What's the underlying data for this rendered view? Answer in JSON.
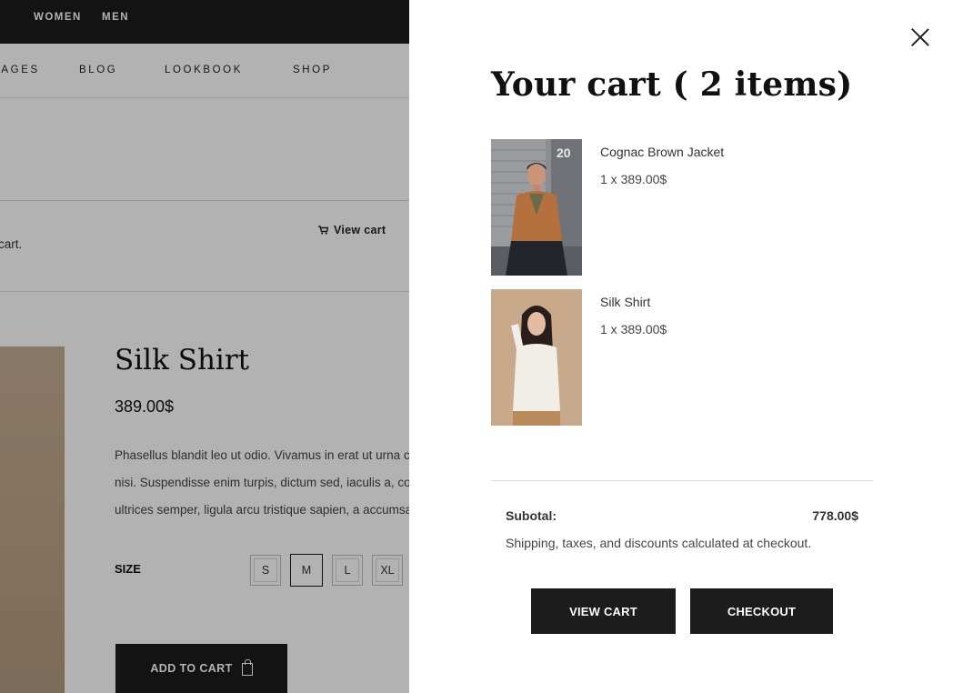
{
  "background": {
    "topbar": {
      "women": "WOMEN",
      "men": "MEN"
    },
    "nav": {
      "pages": "PAGES",
      "blog": "BLOG",
      "lookbook": "LOOKBOOK",
      "shop": "SHOP"
    },
    "notice": {
      "message": "cart.",
      "view_cart": "View cart"
    },
    "product": {
      "title": "Silk Shirt",
      "price": "389.00$",
      "description": [
        "Phasellus blandit leo ut odio. Vivamus in erat ut urna cursus vestibulum.",
        "nisi. Suspendisse enim turpis, dictum sed, iaculis a, condimentum nec, nisi.",
        "ultrices semper, ligula arcu tristique sapien, a accumsan nisi mauris ac eros."
      ],
      "size_label": "SIZE",
      "sizes": [
        "S",
        "M",
        "L",
        "XL"
      ],
      "selected_size": "M",
      "add_to_cart": "ADD TO CART"
    }
  },
  "cart": {
    "title": "Your cart ( 2 items)",
    "items": [
      {
        "name": "Cognac Brown Jacket",
        "qty_price": "1 x 389.00$",
        "badge": "20"
      },
      {
        "name": "Silk Shirt",
        "qty_price": "1 x 389.00$"
      }
    ],
    "subtotal_label": "Subotal:",
    "subtotal_value": "778.00$",
    "shipping_note": "Shipping, taxes, and discounts calculated at checkout.",
    "view_cart_button": "VIEW CART",
    "checkout_button": "CHECKOUT"
  },
  "colors": {
    "dark": "#1c1c1c",
    "overlay": "rgba(0,0,0,0.30)"
  }
}
